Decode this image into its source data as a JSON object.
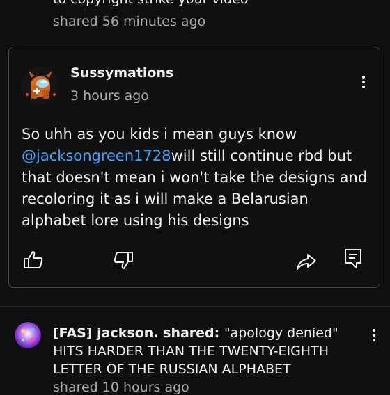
{
  "previous_item": {
    "partial_text": "to copyright strike your video",
    "time": "shared 56 minutes ago"
  },
  "post": {
    "author": "Sussymations",
    "time": "3 hours ago",
    "text_before": "So uhh as you kids i mean guys know ",
    "mention": "@jacksongreen1728",
    "text_after": "will  still continue rbd but that doesn't mean i won't take the designs and recoloring it as i will make a Belarusian alphabet lore using his designs",
    "actions": [
      "like-icon",
      "dislike-icon",
      "share-icon",
      "comment-icon"
    ],
    "menu_icon": "kebab-menu-icon"
  },
  "next_item": {
    "author": "[FAS] jackson.",
    "shared_label": " shared: ",
    "text": "\"apology denied\" HITS HARDER THAN THE TWENTY-EIGHTH LETTER OF THE RUSSIAN ALPHABET",
    "time": "shared 10 hours ago",
    "menu_icon": "kebab-menu-icon"
  },
  "colors": {
    "background": "#0f0f0f",
    "text": "#f1f1f1",
    "secondary_text": "#aaaaaa",
    "mention": "#3ea6ff",
    "card_border": "#4a4a4a"
  }
}
